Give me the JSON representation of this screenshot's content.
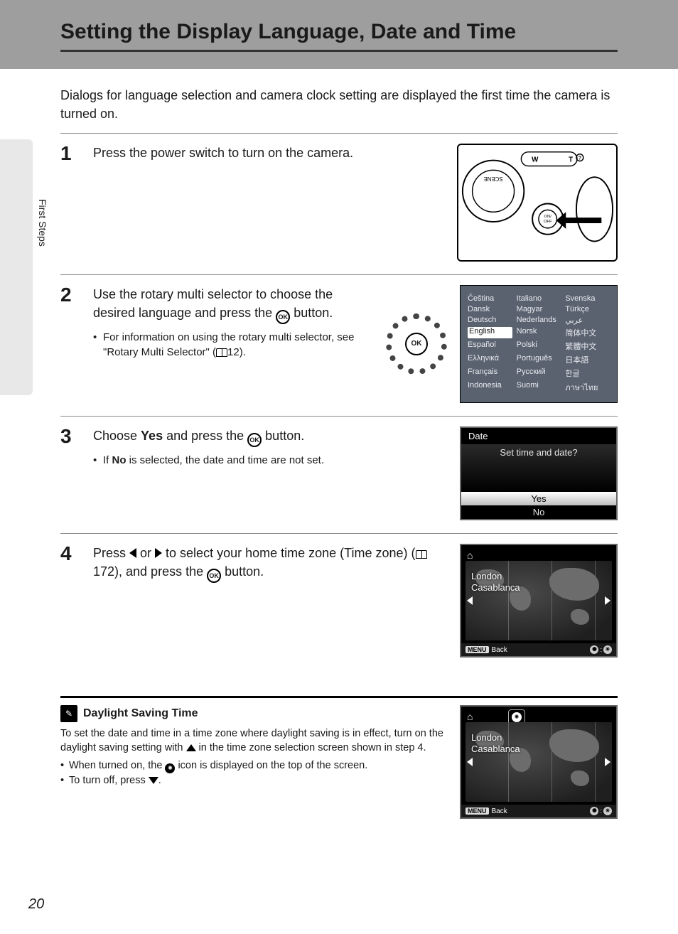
{
  "header": {
    "title": "Setting the Display Language, Date and Time"
  },
  "side_label": "First Steps",
  "page_number": "20",
  "intro": "Dialogs for language selection and camera clock setting are displayed the first time the camera is turned on.",
  "steps": {
    "s1": {
      "num": "1",
      "text": "Press the power switch to turn on the camera."
    },
    "s2": {
      "num": "2",
      "text_a": "Use the rotary multi selector to choose the desired language and press the ",
      "text_b": " button.",
      "sub_a": "For information on using the rotary multi selector, see \"Rotary Multi Selector\" (",
      "sub_b": "12)."
    },
    "s3": {
      "num": "3",
      "text_a": "Choose ",
      "text_yes": "Yes",
      "text_b": " and press the ",
      "text_c": " button.",
      "sub_a": "If ",
      "sub_no": "No",
      "sub_b": " is selected, the date and time are not set."
    },
    "s4": {
      "num": "4",
      "text_a": "Press ",
      "text_b": " or ",
      "text_c": " to select your home time zone (Time zone) (",
      "text_d": "172), and press the ",
      "text_e": " button."
    }
  },
  "note": {
    "title": "Daylight Saving Time",
    "p_a": "To set the date and time in a time zone where daylight saving is in effect, turn on the daylight saving setting with ",
    "p_b": " in the time zone selection screen shown in step 4.",
    "li1_a": "When turned on, the ",
    "li1_b": " icon is displayed on the top of the screen.",
    "li2_a": "To turn off, press ",
    "li2_b": "."
  },
  "lang_screen": {
    "col1": [
      "Čeština",
      "Dansk",
      "Deutsch",
      "English",
      "Español",
      "Ελληνικά",
      "Français",
      "Indonesia"
    ],
    "col2": [
      "Italiano",
      "Magyar",
      "Nederlands",
      "Norsk",
      "Polski",
      "Português",
      "Русский",
      "Suomi"
    ],
    "col3": [
      "Svenska",
      "Türkçe",
      "عربي",
      "简体中文",
      "繁體中文",
      "日本語",
      "한글",
      "ภาษาไทย"
    ],
    "selected": "English"
  },
  "date_screen": {
    "title": "Date",
    "prompt": "Set time and date?",
    "yes": "Yes",
    "no": "No"
  },
  "tz_screen": {
    "city1": "London",
    "city2": "Casablanca",
    "menu": "MENU",
    "back": "Back"
  },
  "icons": {
    "ok": "OK",
    "rotary_ok": "OK",
    "on_off": "ON/\nOFF",
    "home": "⌂",
    "dst": "✺"
  }
}
